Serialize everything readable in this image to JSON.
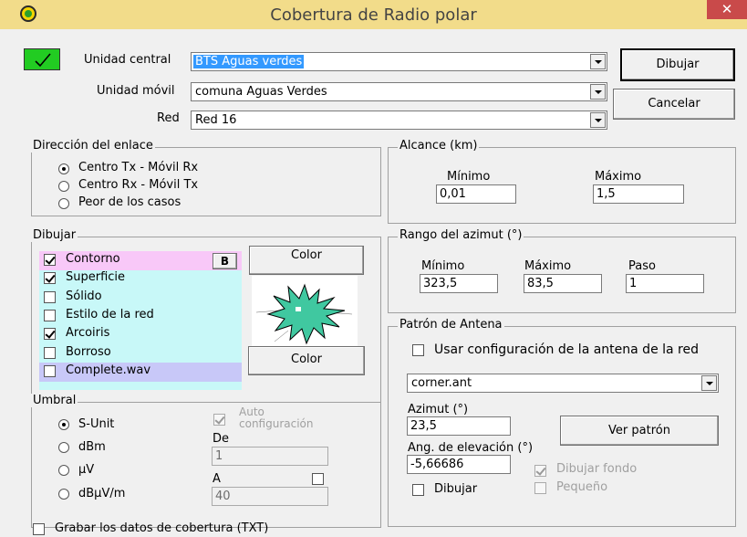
{
  "window": {
    "title": "Cobertura de Radio polar",
    "close_glyph": "✕"
  },
  "header": {
    "unidad_central_label": "Unidad central",
    "unidad_central_value": "BTS Aguas verdes",
    "unidad_movil_label": "Unidad móvil",
    "unidad_movil_value": "comuna Aguas Verdes",
    "red_label": "Red",
    "red_value": "Red 16",
    "status_color": "#22cc22"
  },
  "buttons": {
    "dibujar": "Dibujar",
    "cancelar": "Cancelar"
  },
  "direccion": {
    "title": "Dirección del enlace",
    "options": [
      "Centro Tx - Móvil Rx",
      "Centro Rx - Móvil Tx",
      "Peor de los casos"
    ],
    "selected": 0
  },
  "alcance": {
    "title": "Alcance (km)",
    "min_label": "Mínimo",
    "min_value": "0,01",
    "max_label": "Máximo",
    "max_value": "1,5"
  },
  "dibujar": {
    "title": "Dibujar",
    "items": [
      {
        "label": "Contorno",
        "checked": true
      },
      {
        "label": "Superficie",
        "checked": true
      },
      {
        "label": "Sólido",
        "checked": false
      },
      {
        "label": "Estilo de la red",
        "checked": false
      },
      {
        "label": "Arcoiris",
        "checked": true
      },
      {
        "label": "Borroso",
        "checked": false
      },
      {
        "label": "Complete.wav",
        "checked": false
      }
    ],
    "b_label": "B",
    "color_label_1": "Color",
    "color_label_2": "Color",
    "colors": {
      "contorno_bg": "#f8c8f8",
      "list_bg": "#c8f8f8",
      "wav_bg": "#c8c8f8",
      "preview_fill": "#40c8a0"
    }
  },
  "azimut_range": {
    "title": "Rango del azimut (°)",
    "min_label": "Mínimo",
    "min_value": "323,5",
    "max_label": "Máximo",
    "max_value": "83,5",
    "paso_label": "Paso",
    "paso_value": "1"
  },
  "antena": {
    "title": "Patrón de Antena",
    "use_network_label": "Usar configuración de la antena de la red",
    "use_network_checked": false,
    "pattern_value": "corner.ant",
    "azimut_label": "Azimut (°)",
    "azimut_value": "23,5",
    "elev_label": "Ang. de elevación (°)",
    "elev_value": "-5,66686",
    "ver_patron": "Ver patrón",
    "dibujar_fondo_label": "Dibujar fondo",
    "dibujar_fondo_checked": true,
    "dibujar_label": "Dibujar",
    "dibujar_checked": false,
    "pequeno_label": "Pequeño",
    "pequeno_checked": false
  },
  "umbral": {
    "title": "Umbral",
    "options": [
      "S-Unit",
      "dBm",
      "µV",
      "dBµV/m"
    ],
    "selected": 0,
    "auto_label_1": "Auto",
    "auto_label_2": "configuración",
    "auto_checked": true,
    "de_label": "De",
    "de_value": "1",
    "a_label": "A",
    "a_value": "40",
    "a_checked": false
  },
  "grabar": {
    "label": "Grabar los datos de cobertura (TXT)",
    "checked": false
  }
}
